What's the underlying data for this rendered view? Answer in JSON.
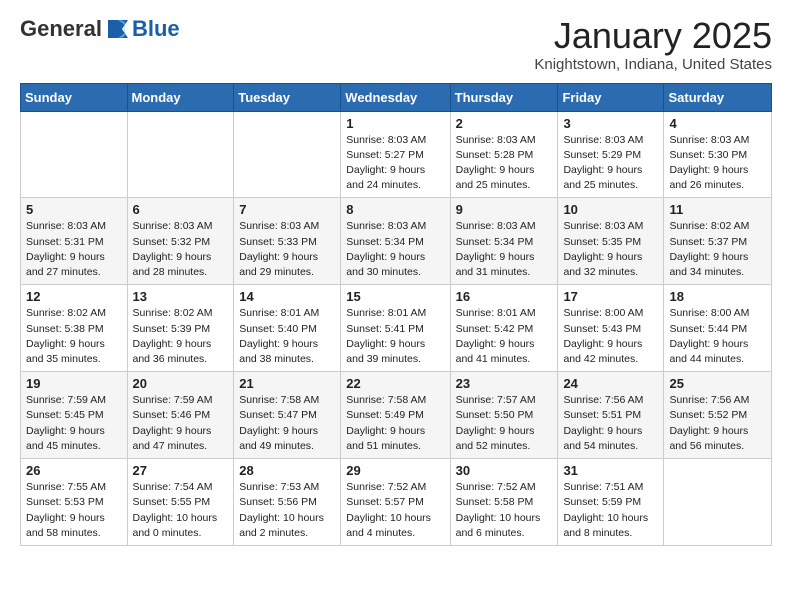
{
  "logo": {
    "general": "General",
    "blue": "Blue"
  },
  "header": {
    "month": "January 2025",
    "location": "Knightstown, Indiana, United States"
  },
  "weekdays": [
    "Sunday",
    "Monday",
    "Tuesday",
    "Wednesday",
    "Thursday",
    "Friday",
    "Saturday"
  ],
  "weeks": [
    [
      {
        "day": "",
        "info": ""
      },
      {
        "day": "",
        "info": ""
      },
      {
        "day": "",
        "info": ""
      },
      {
        "day": "1",
        "info": "Sunrise: 8:03 AM\nSunset: 5:27 PM\nDaylight: 9 hours\nand 24 minutes."
      },
      {
        "day": "2",
        "info": "Sunrise: 8:03 AM\nSunset: 5:28 PM\nDaylight: 9 hours\nand 25 minutes."
      },
      {
        "day": "3",
        "info": "Sunrise: 8:03 AM\nSunset: 5:29 PM\nDaylight: 9 hours\nand 25 minutes."
      },
      {
        "day": "4",
        "info": "Sunrise: 8:03 AM\nSunset: 5:30 PM\nDaylight: 9 hours\nand 26 minutes."
      }
    ],
    [
      {
        "day": "5",
        "info": "Sunrise: 8:03 AM\nSunset: 5:31 PM\nDaylight: 9 hours\nand 27 minutes."
      },
      {
        "day": "6",
        "info": "Sunrise: 8:03 AM\nSunset: 5:32 PM\nDaylight: 9 hours\nand 28 minutes."
      },
      {
        "day": "7",
        "info": "Sunrise: 8:03 AM\nSunset: 5:33 PM\nDaylight: 9 hours\nand 29 minutes."
      },
      {
        "day": "8",
        "info": "Sunrise: 8:03 AM\nSunset: 5:34 PM\nDaylight: 9 hours\nand 30 minutes."
      },
      {
        "day": "9",
        "info": "Sunrise: 8:03 AM\nSunset: 5:34 PM\nDaylight: 9 hours\nand 31 minutes."
      },
      {
        "day": "10",
        "info": "Sunrise: 8:03 AM\nSunset: 5:35 PM\nDaylight: 9 hours\nand 32 minutes."
      },
      {
        "day": "11",
        "info": "Sunrise: 8:02 AM\nSunset: 5:37 PM\nDaylight: 9 hours\nand 34 minutes."
      }
    ],
    [
      {
        "day": "12",
        "info": "Sunrise: 8:02 AM\nSunset: 5:38 PM\nDaylight: 9 hours\nand 35 minutes."
      },
      {
        "day": "13",
        "info": "Sunrise: 8:02 AM\nSunset: 5:39 PM\nDaylight: 9 hours\nand 36 minutes."
      },
      {
        "day": "14",
        "info": "Sunrise: 8:01 AM\nSunset: 5:40 PM\nDaylight: 9 hours\nand 38 minutes."
      },
      {
        "day": "15",
        "info": "Sunrise: 8:01 AM\nSunset: 5:41 PM\nDaylight: 9 hours\nand 39 minutes."
      },
      {
        "day": "16",
        "info": "Sunrise: 8:01 AM\nSunset: 5:42 PM\nDaylight: 9 hours\nand 41 minutes."
      },
      {
        "day": "17",
        "info": "Sunrise: 8:00 AM\nSunset: 5:43 PM\nDaylight: 9 hours\nand 42 minutes."
      },
      {
        "day": "18",
        "info": "Sunrise: 8:00 AM\nSunset: 5:44 PM\nDaylight: 9 hours\nand 44 minutes."
      }
    ],
    [
      {
        "day": "19",
        "info": "Sunrise: 7:59 AM\nSunset: 5:45 PM\nDaylight: 9 hours\nand 45 minutes."
      },
      {
        "day": "20",
        "info": "Sunrise: 7:59 AM\nSunset: 5:46 PM\nDaylight: 9 hours\nand 47 minutes."
      },
      {
        "day": "21",
        "info": "Sunrise: 7:58 AM\nSunset: 5:47 PM\nDaylight: 9 hours\nand 49 minutes."
      },
      {
        "day": "22",
        "info": "Sunrise: 7:58 AM\nSunset: 5:49 PM\nDaylight: 9 hours\nand 51 minutes."
      },
      {
        "day": "23",
        "info": "Sunrise: 7:57 AM\nSunset: 5:50 PM\nDaylight: 9 hours\nand 52 minutes."
      },
      {
        "day": "24",
        "info": "Sunrise: 7:56 AM\nSunset: 5:51 PM\nDaylight: 9 hours\nand 54 minutes."
      },
      {
        "day": "25",
        "info": "Sunrise: 7:56 AM\nSunset: 5:52 PM\nDaylight: 9 hours\nand 56 minutes."
      }
    ],
    [
      {
        "day": "26",
        "info": "Sunrise: 7:55 AM\nSunset: 5:53 PM\nDaylight: 9 hours\nand 58 minutes."
      },
      {
        "day": "27",
        "info": "Sunrise: 7:54 AM\nSunset: 5:55 PM\nDaylight: 10 hours\nand 0 minutes."
      },
      {
        "day": "28",
        "info": "Sunrise: 7:53 AM\nSunset: 5:56 PM\nDaylight: 10 hours\nand 2 minutes."
      },
      {
        "day": "29",
        "info": "Sunrise: 7:52 AM\nSunset: 5:57 PM\nDaylight: 10 hours\nand 4 minutes."
      },
      {
        "day": "30",
        "info": "Sunrise: 7:52 AM\nSunset: 5:58 PM\nDaylight: 10 hours\nand 6 minutes."
      },
      {
        "day": "31",
        "info": "Sunrise: 7:51 AM\nSunset: 5:59 PM\nDaylight: 10 hours\nand 8 minutes."
      },
      {
        "day": "",
        "info": ""
      }
    ]
  ]
}
